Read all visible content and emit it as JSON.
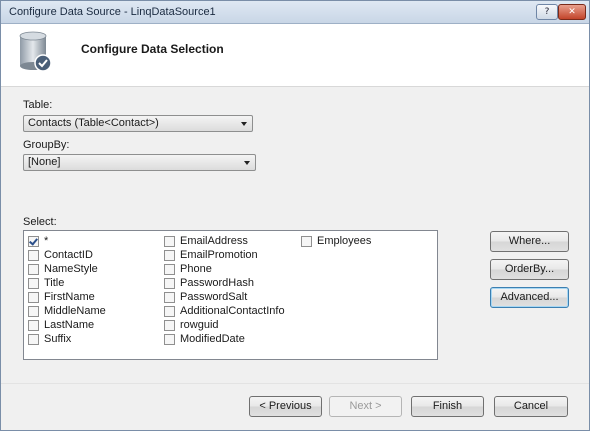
{
  "window": {
    "title": "Configure Data Source - LinqDataSource1",
    "help_label": "?",
    "close_label": "✕"
  },
  "header": {
    "title": "Configure Data Selection",
    "icon": "database-icon"
  },
  "table": {
    "label": "Table:",
    "value": "Contacts (Table<Contact>)"
  },
  "groupby": {
    "label": "GroupBy:",
    "value": "[None]"
  },
  "select": {
    "label": "Select:",
    "columns": [
      [
        {
          "label": "*",
          "checked": true
        },
        {
          "label": "ContactID",
          "checked": false
        },
        {
          "label": "NameStyle",
          "checked": false
        },
        {
          "label": "Title",
          "checked": false
        },
        {
          "label": "FirstName",
          "checked": false
        },
        {
          "label": "MiddleName",
          "checked": false
        },
        {
          "label": "LastName",
          "checked": false
        },
        {
          "label": "Suffix",
          "checked": false
        }
      ],
      [
        {
          "label": "EmailAddress",
          "checked": false
        },
        {
          "label": "EmailPromotion",
          "checked": false
        },
        {
          "label": "Phone",
          "checked": false
        },
        {
          "label": "PasswordHash",
          "checked": false
        },
        {
          "label": "PasswordSalt",
          "checked": false
        },
        {
          "label": "AdditionalContactInfo",
          "checked": false
        },
        {
          "label": "rowguid",
          "checked": false
        },
        {
          "label": "ModifiedDate",
          "checked": false
        }
      ],
      [
        {
          "label": "Employees",
          "checked": false
        }
      ]
    ]
  },
  "side_buttons": {
    "where": "Where...",
    "orderby": "OrderBy...",
    "advanced": "Advanced..."
  },
  "footer": {
    "previous": "< Previous",
    "next": "Next >",
    "finish": "Finish",
    "cancel": "Cancel"
  }
}
